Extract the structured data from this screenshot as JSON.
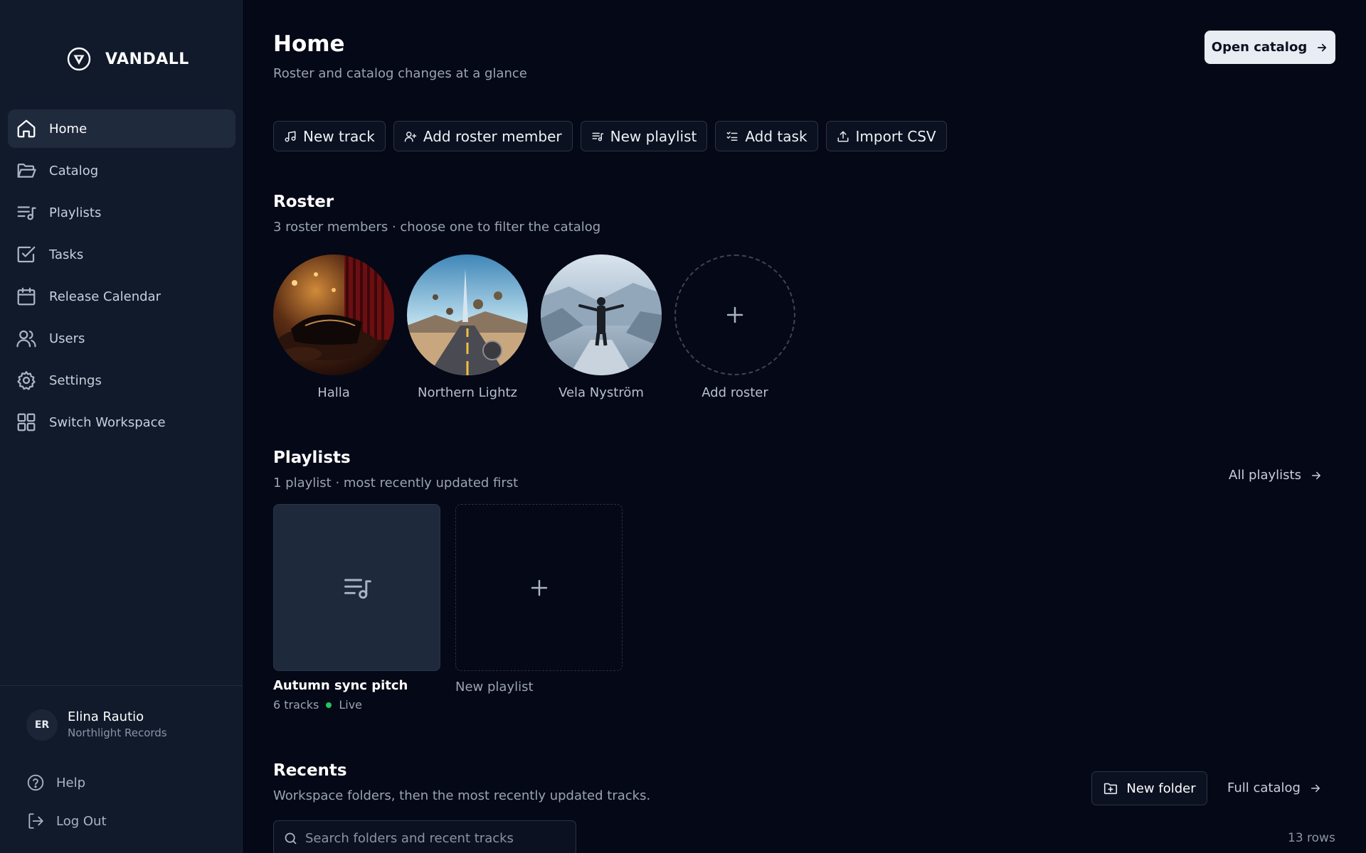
{
  "brand": {
    "name": "VANDALL"
  },
  "sidebar": {
    "items": [
      {
        "label": "Home",
        "icon": "home-icon",
        "active": true
      },
      {
        "label": "Catalog",
        "icon": "folder-open-icon"
      },
      {
        "label": "Playlists",
        "icon": "playlist-icon"
      },
      {
        "label": "Tasks",
        "icon": "checkbox-icon"
      },
      {
        "label": "Release Calendar",
        "icon": "calendar-icon"
      },
      {
        "label": "Users",
        "icon": "users-icon"
      },
      {
        "label": "Settings",
        "icon": "gear-icon"
      },
      {
        "label": "Switch Workspace",
        "icon": "grid-icon"
      }
    ],
    "user": {
      "initials": "ER",
      "name": "Elina Rautio",
      "org": "Northlight Records"
    },
    "help_label": "Help",
    "logout_label": "Log Out"
  },
  "header": {
    "title": "Home",
    "subtitle": "Roster and catalog changes at a glance",
    "open_catalog_label": "Open catalog"
  },
  "actions": [
    {
      "label": "New track",
      "icon": "music-note-icon"
    },
    {
      "label": "Add roster member",
      "icon": "user-plus-icon"
    },
    {
      "label": "New playlist",
      "icon": "playlist-add-icon"
    },
    {
      "label": "Add task",
      "icon": "task-list-icon"
    },
    {
      "label": "Import CSV",
      "icon": "upload-icon"
    }
  ],
  "roster": {
    "title": "Roster",
    "subtitle": "3 roster members · choose one to filter the catalog",
    "members": [
      {
        "name": "Halla"
      },
      {
        "name": "Northern Lightz"
      },
      {
        "name": "Vela Nyström"
      }
    ],
    "add_label": "Add roster"
  },
  "playlists": {
    "title": "Playlists",
    "subtitle": "1 playlist · most recently updated first",
    "all_label": "All playlists",
    "items": [
      {
        "title": "Autumn sync pitch",
        "tracks": "6 tracks",
        "status": "Live"
      }
    ],
    "new_label": "New playlist"
  },
  "recents": {
    "title": "Recents",
    "subtitle": "Workspace folders, then the most recently updated tracks.",
    "new_folder_label": "New folder",
    "full_catalog_label": "Full catalog",
    "search_placeholder": "Search folders and recent tracks",
    "rows_count": "13 rows"
  },
  "colors": {
    "background": "#050816",
    "sidebar": "#111a2b",
    "accent_button": "#e8ecf3",
    "live_status": "#22c55e"
  }
}
